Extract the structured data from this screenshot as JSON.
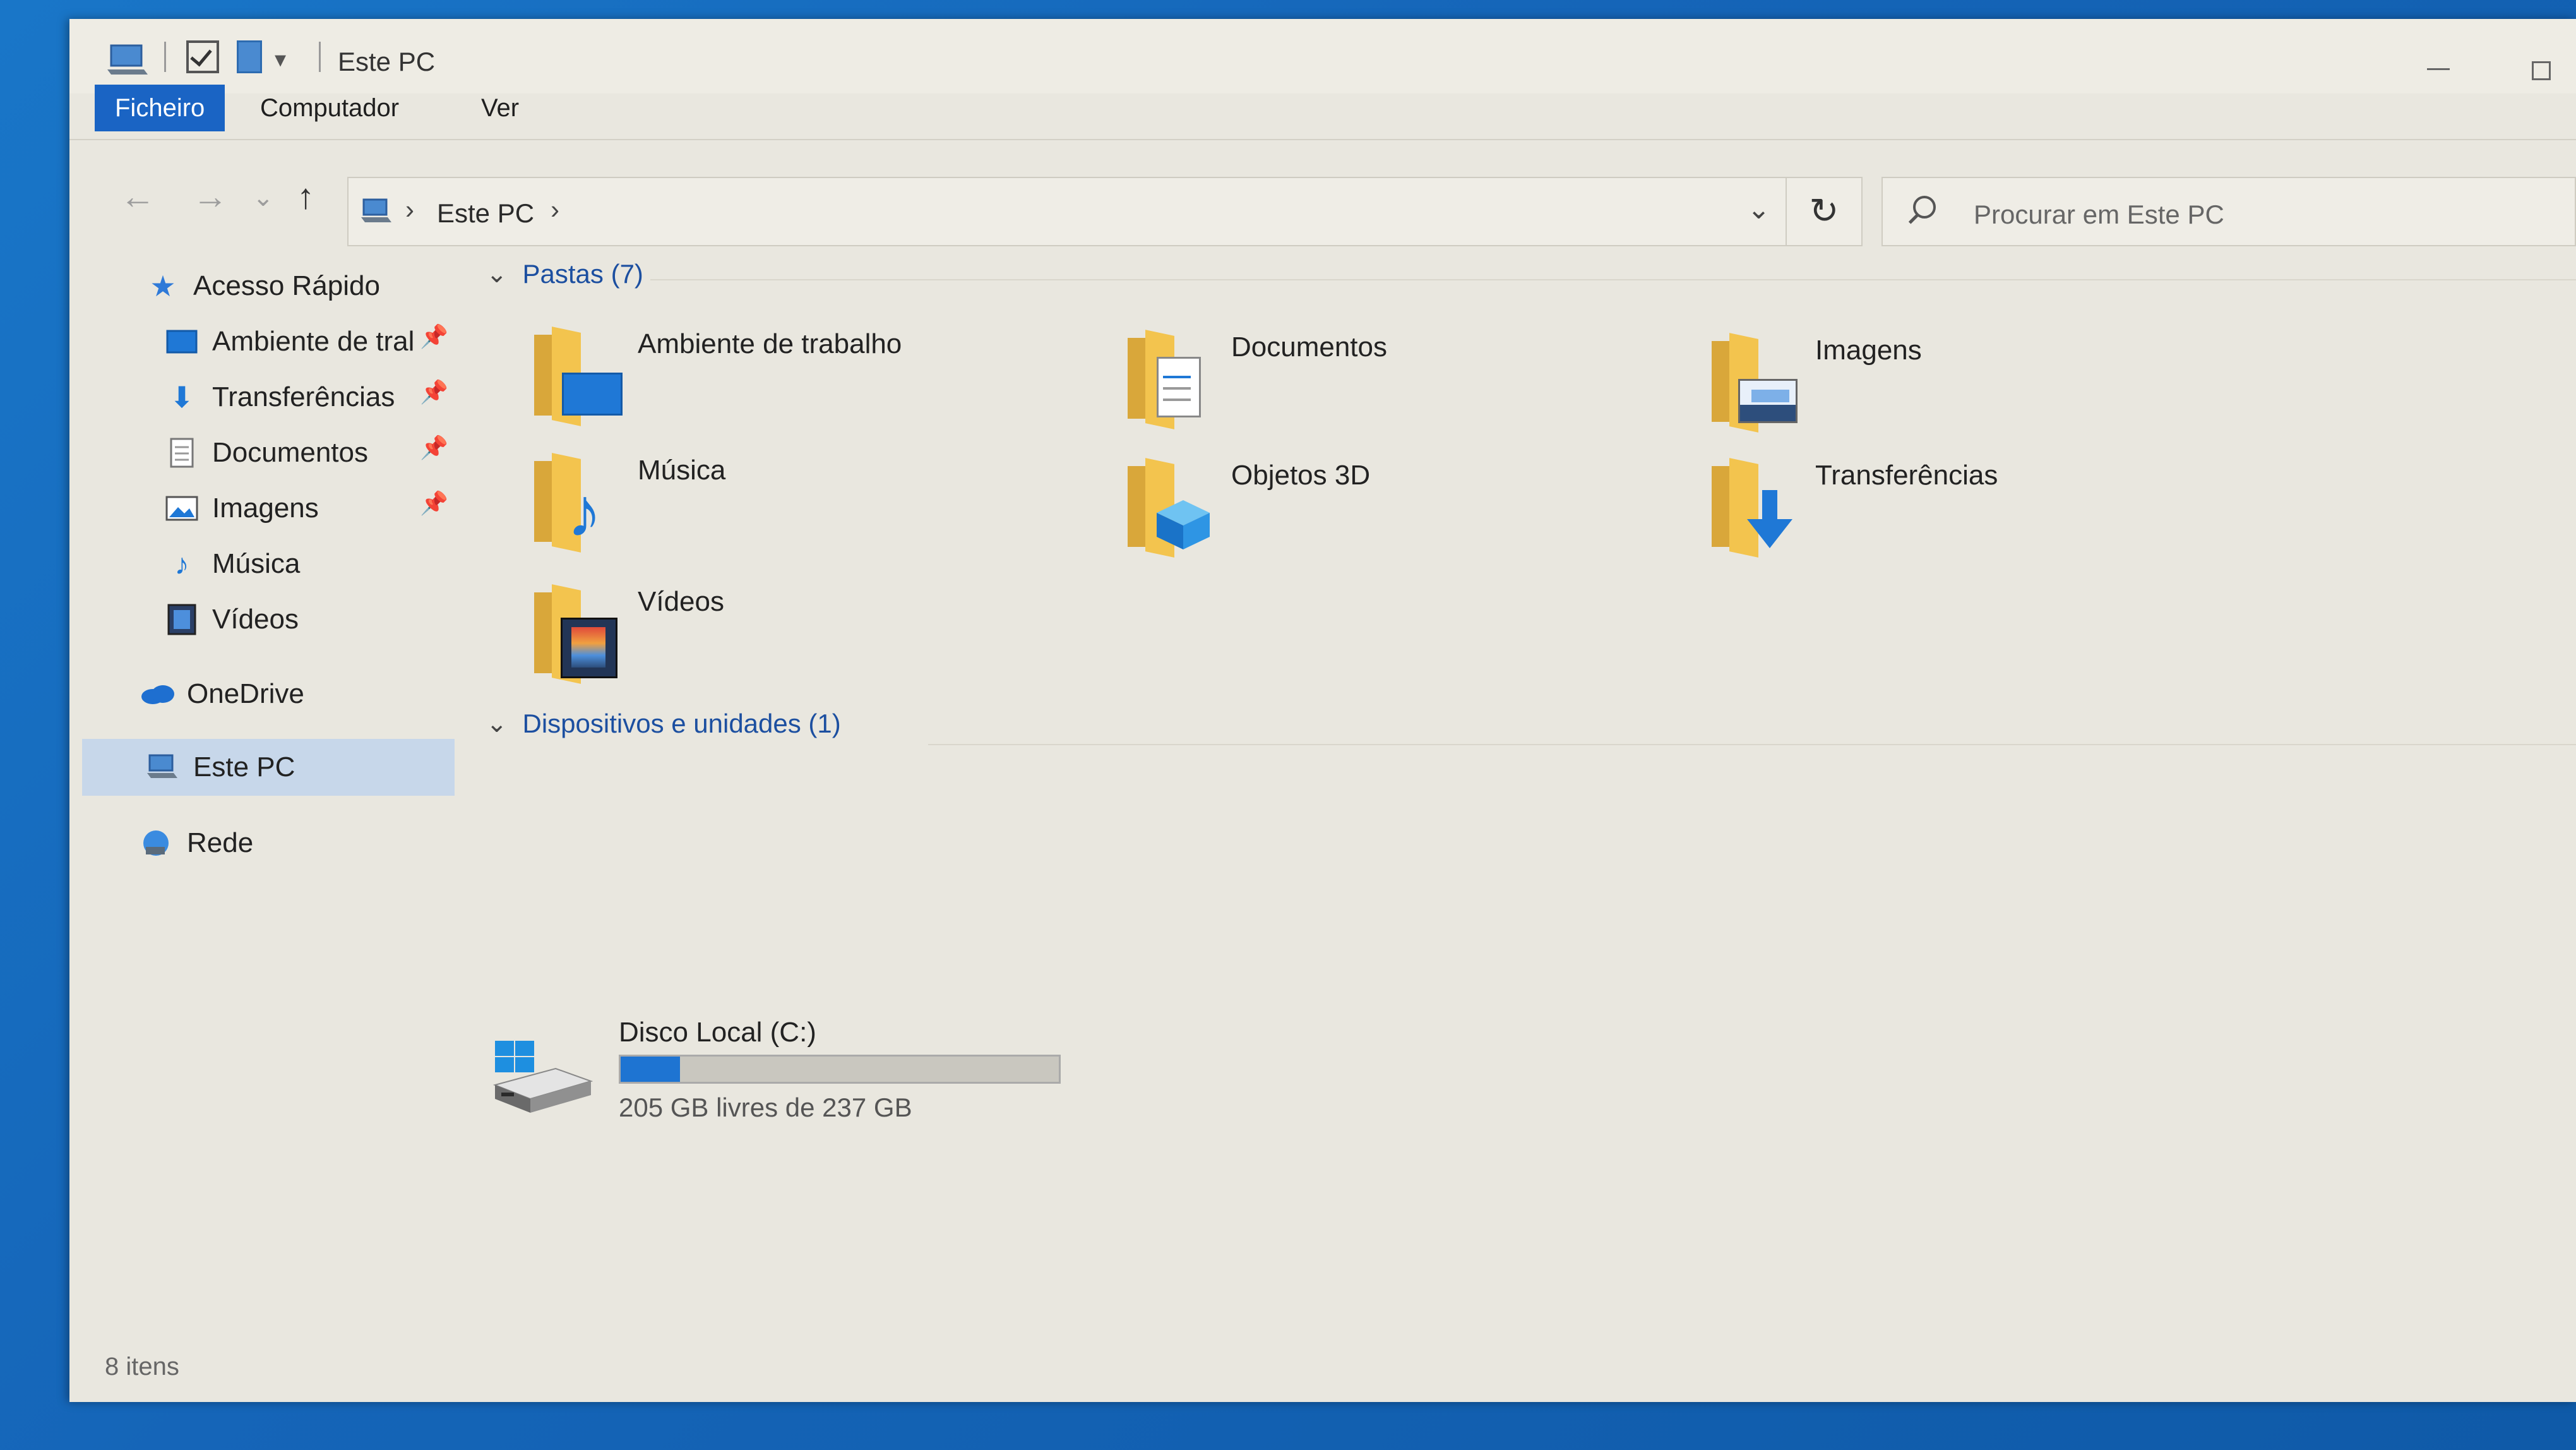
{
  "window": {
    "title": "Este PC"
  },
  "ribbon": {
    "tabs": [
      {
        "label": "Ficheiro",
        "active": true
      },
      {
        "label": "Computador",
        "active": false
      },
      {
        "label": "Ver",
        "active": false
      }
    ]
  },
  "address": {
    "crumb": "Este PC"
  },
  "search": {
    "placeholder": "Procurar em Este PC"
  },
  "sidebar": {
    "quick_access": "Acesso Rápido",
    "items": [
      {
        "label": "Ambiente de tral",
        "icon": "desktop-icon",
        "pinned": true
      },
      {
        "label": "Transferências",
        "icon": "download-icon",
        "pinned": true
      },
      {
        "label": "Documentos",
        "icon": "document-icon",
        "pinned": true
      },
      {
        "label": "Imagens",
        "icon": "image-icon",
        "pinned": true
      },
      {
        "label": "Música",
        "icon": "music-icon",
        "pinned": false
      },
      {
        "label": "Vídeos",
        "icon": "video-icon",
        "pinned": false
      }
    ],
    "onedrive": "OneDrive",
    "this_pc": "Este PC",
    "network": "Rede"
  },
  "folders": {
    "header": "Pastas (7)",
    "items": [
      {
        "label": "Ambiente de trabalho",
        "icon": "desktop-folder-icon"
      },
      {
        "label": "Documentos",
        "icon": "documents-folder-icon"
      },
      {
        "label": "Imagens",
        "icon": "images-folder-icon"
      },
      {
        "label": "Música",
        "icon": "music-folder-icon"
      },
      {
        "label": "Objetos 3D",
        "icon": "3d-objects-folder-icon"
      },
      {
        "label": "Transferências",
        "icon": "downloads-folder-icon"
      },
      {
        "label": "Vídeos",
        "icon": "videos-folder-icon"
      }
    ]
  },
  "devices": {
    "header": "Dispositivos e unidades (1)",
    "drive": {
      "name": "Disco Local (C:)",
      "free_text": "205 GB livres de 237 GB",
      "used_fraction": 0.135
    }
  },
  "status": {
    "items": "8 itens"
  },
  "colors": {
    "accent": "#1a64c4",
    "folder": "#f3c44e",
    "drive_fill": "#1e74d2"
  }
}
